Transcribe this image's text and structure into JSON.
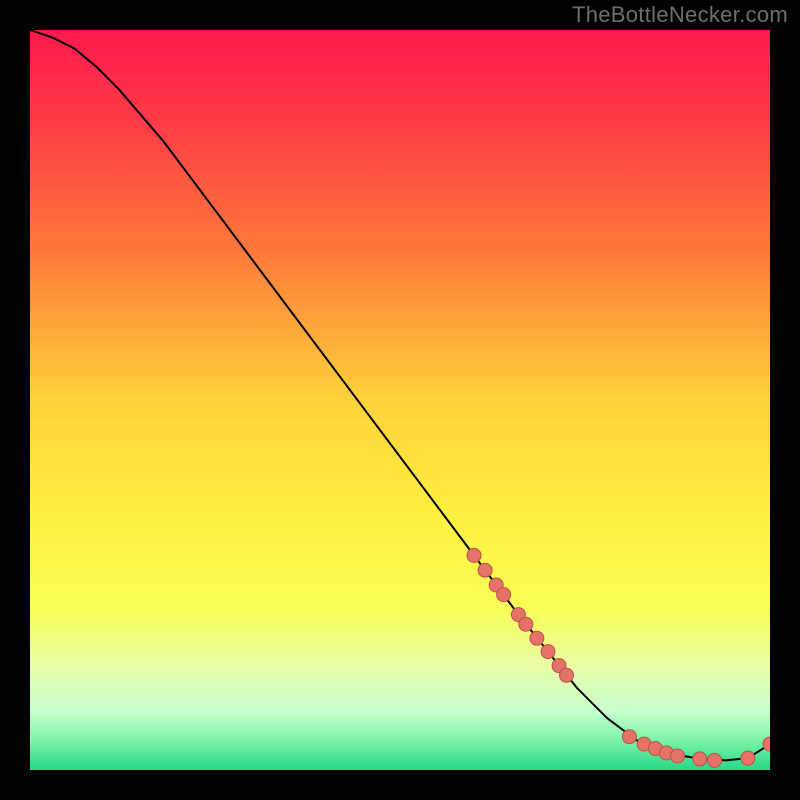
{
  "watermark": "TheBottleNecker.com",
  "chart_data": {
    "type": "line",
    "xlabel": "",
    "ylabel": "",
    "xlim": [
      0,
      100
    ],
    "ylim": [
      0,
      100
    ],
    "background_gradient": {
      "stops": [
        {
          "offset": 0.0,
          "color": "#ff1a4d"
        },
        {
          "offset": 0.12,
          "color": "#ff3a47"
        },
        {
          "offset": 0.3,
          "color": "#ff7a3a"
        },
        {
          "offset": 0.5,
          "color": "#ffd23a"
        },
        {
          "offset": 0.65,
          "color": "#ffee3f"
        },
        {
          "offset": 0.78,
          "color": "#f9ff55"
        },
        {
          "offset": 0.86,
          "color": "#e9ffa6"
        },
        {
          "offset": 0.92,
          "color": "#c8ffcf"
        },
        {
          "offset": 0.96,
          "color": "#7cf3a6"
        },
        {
          "offset": 1.0,
          "color": "#25d886"
        }
      ]
    },
    "series": [
      {
        "name": "bottleneck-curve",
        "color": "#000000",
        "stroke_width": 2.0,
        "x": [
          0,
          3,
          6,
          9,
          12,
          18,
          24,
          30,
          36,
          42,
          48,
          54,
          60,
          66,
          70,
          74,
          78,
          82,
          86,
          90,
          94,
          97,
          100
        ],
        "y": [
          100,
          99,
          97.5,
          95,
          92,
          85,
          77,
          69,
          61,
          53,
          45,
          37,
          29,
          21,
          16,
          11,
          7,
          4,
          2.3,
          1.6,
          1.3,
          1.6,
          3.5
        ]
      }
    ],
    "highlight_points": {
      "name": "highlight-dots",
      "color": "#e57368",
      "radius": 7,
      "stroke": "#b85249",
      "points": [
        {
          "x": 60.0,
          "y": 29.0
        },
        {
          "x": 61.5,
          "y": 27.0
        },
        {
          "x": 63.0,
          "y": 25.0
        },
        {
          "x": 64.0,
          "y": 23.7
        },
        {
          "x": 66.0,
          "y": 21.0
        },
        {
          "x": 67.0,
          "y": 19.7
        },
        {
          "x": 68.5,
          "y": 17.8
        },
        {
          "x": 70.0,
          "y": 16.0
        },
        {
          "x": 71.5,
          "y": 14.1
        },
        {
          "x": 72.5,
          "y": 12.8
        },
        {
          "x": 81.0,
          "y": 4.5
        },
        {
          "x": 83.0,
          "y": 3.5
        },
        {
          "x": 84.5,
          "y": 2.9
        },
        {
          "x": 86.0,
          "y": 2.3
        },
        {
          "x": 87.5,
          "y": 1.9
        },
        {
          "x": 90.5,
          "y": 1.5
        },
        {
          "x": 92.5,
          "y": 1.3
        },
        {
          "x": 97.0,
          "y": 1.6
        },
        {
          "x": 100.0,
          "y": 3.5
        }
      ]
    }
  }
}
